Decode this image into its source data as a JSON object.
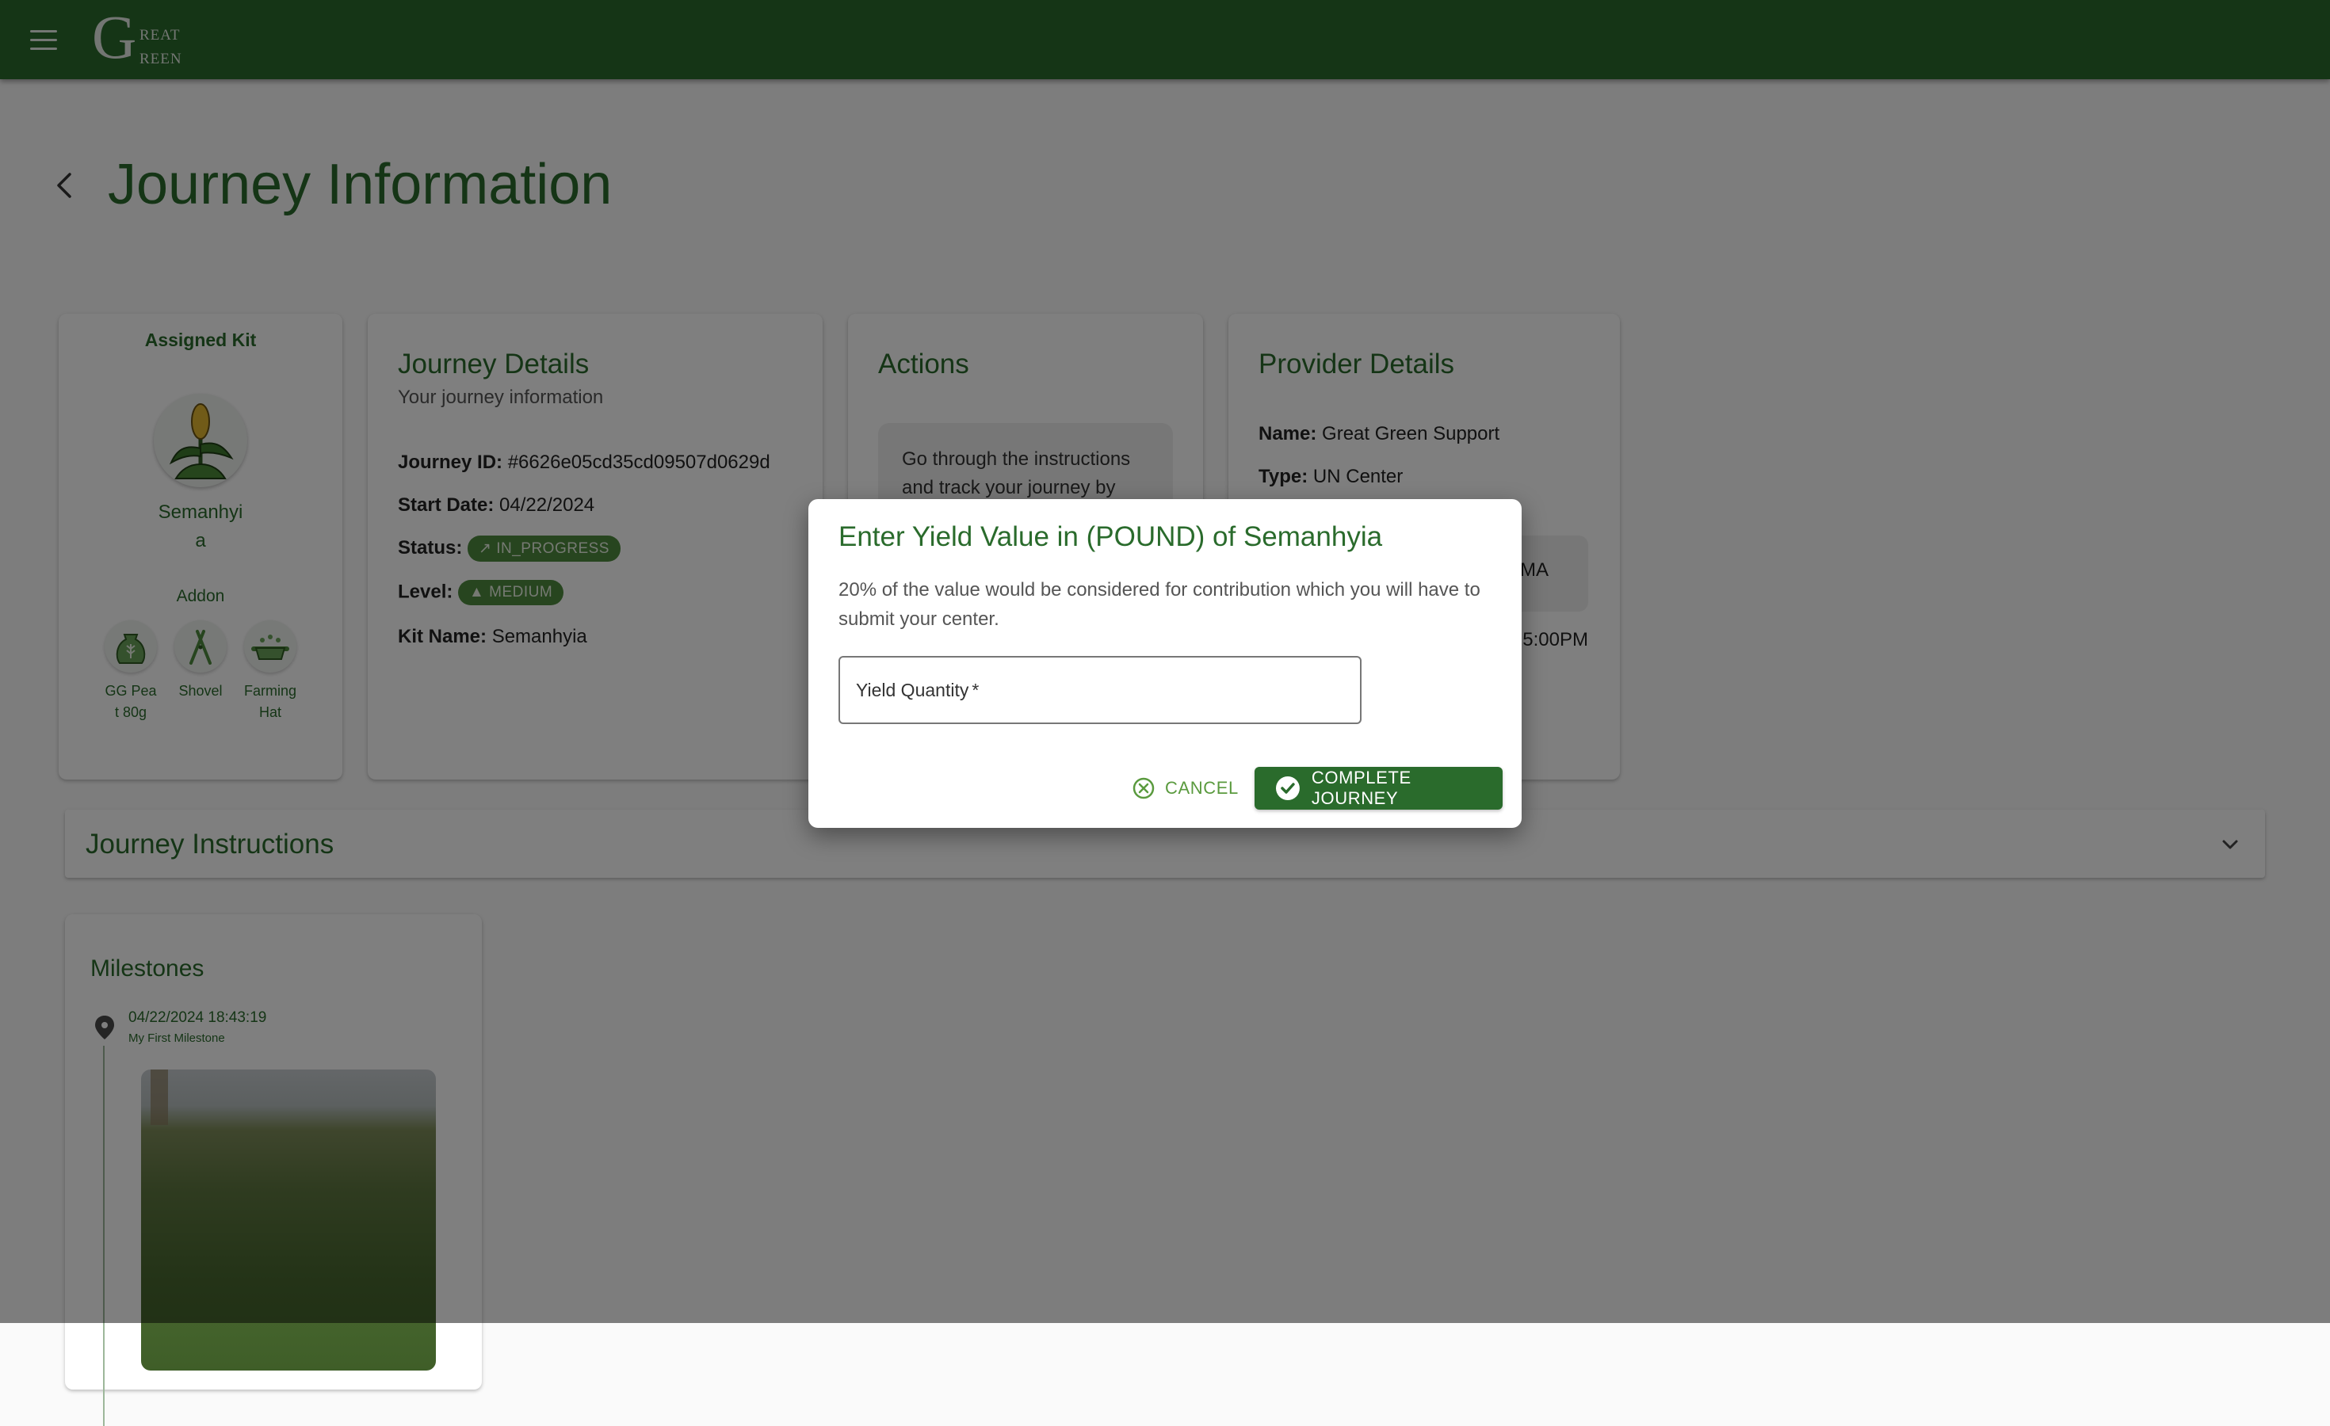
{
  "header": {
    "logo_big": "G",
    "logo_line1": "REAT",
    "logo_line2": "REEN"
  },
  "page": {
    "title": "Journey Information"
  },
  "kit": {
    "title": "Assigned Kit",
    "name": "Semanhyia",
    "addon_label": "Addon",
    "addons": [
      {
        "name": "GG Peat 80g",
        "icon": "seed-bag-icon"
      },
      {
        "name": "Shovel",
        "icon": "shears-icon"
      },
      {
        "name": "Farming Hat",
        "icon": "hat-icon"
      }
    ]
  },
  "details": {
    "title": "Journey Details",
    "subtitle": "Your journey information",
    "journey_id_label": "Journey ID:",
    "journey_id": "#6626e05cd35cd09507d0629d",
    "start_date_label": "Start Date:",
    "start_date": "04/22/2024",
    "status_label": "Status:",
    "status": "IN_PROGRESS",
    "level_label": "Level:",
    "level": "MEDIUM",
    "kit_name_label": "Kit Name:",
    "kit_name": "Semanhyia"
  },
  "actions": {
    "title": "Actions",
    "text": "Go through the instructions and track your journey by"
  },
  "provider": {
    "title": "Provider Details",
    "name_label": "Name:",
    "name": "Great Green Support",
    "type_label": "Type:",
    "type": "UN Center",
    "fragment1": "MA",
    "fragment2": "5:00PM"
  },
  "instructions": {
    "title": "Journey Instructions"
  },
  "milestones": {
    "title": "Milestones",
    "items": [
      {
        "date": "04/22/2024 18:43:19",
        "text": "My First Milestone"
      }
    ]
  },
  "dialog": {
    "title": "Enter Yield Value in (POUND) of Semanhyia",
    "body": "20% of the value would be considered for contribution which you will have to submit your center.",
    "input_label": "Yield Quantity",
    "required_mark": "*",
    "cancel_label": "CANCEL",
    "complete_label": "COMPLETE JOURNEY"
  },
  "colors": {
    "primary": "#2a6b2c",
    "chip": "#4f8a3e",
    "overlay": "rgba(0,0,0,0.5)"
  }
}
